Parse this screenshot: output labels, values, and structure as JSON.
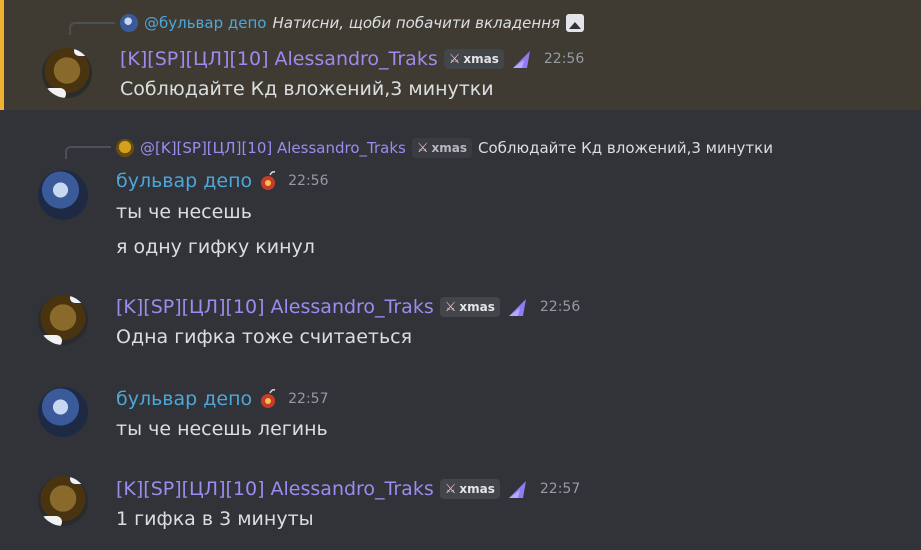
{
  "messages": [
    {
      "author": "[K][SP][ЦЛ][10] Alessandro_Traks",
      "tag": "xmas",
      "time": "22:56",
      "reply": {
        "mention": "@бульвар депо",
        "text": "Натисни, щоби побачити вкладення"
      },
      "lines": [
        "Соблюдайте Кд вложений,3 минутки"
      ]
    },
    {
      "author": "бульвар депо",
      "time": "22:56",
      "reply": {
        "mention": "@[K][SP][ЦЛ][10] Alessandro_Traks",
        "tag": "xmas",
        "text": "Соблюдайте Кд вложений,3 минутки"
      },
      "lines": [
        "ты че несешь",
        "я одну гифку кинул"
      ]
    },
    {
      "author": "[K][SP][ЦЛ][10] Alessandro_Traks",
      "tag": "xmas",
      "time": "22:56",
      "lines": [
        "Одна гифка тоже считаеться"
      ]
    },
    {
      "author": "бульвар депо",
      "time": "22:57",
      "lines": [
        "ты че несешь легинь"
      ]
    },
    {
      "author": "[K][SP][ЦЛ][10] Alessandro_Traks",
      "tag": "xmas",
      "time": "22:57",
      "lines": [
        "1 гифка в 3 минуты"
      ]
    }
  ],
  "colors": {
    "background": "#313338",
    "highlight_bg": "#3f3b32",
    "highlight_bar": "#f0b232",
    "alex_name": "#9b8cf0",
    "bulvar_name": "#4da7d9",
    "text": "#dbdee1",
    "timestamp": "#949ba4"
  },
  "icons": {
    "attachment": "image-icon",
    "role_alex": "purple-wing-icon",
    "role_bulvar": "red-bomb-icon",
    "tag": "crossed-swords-icon"
  }
}
